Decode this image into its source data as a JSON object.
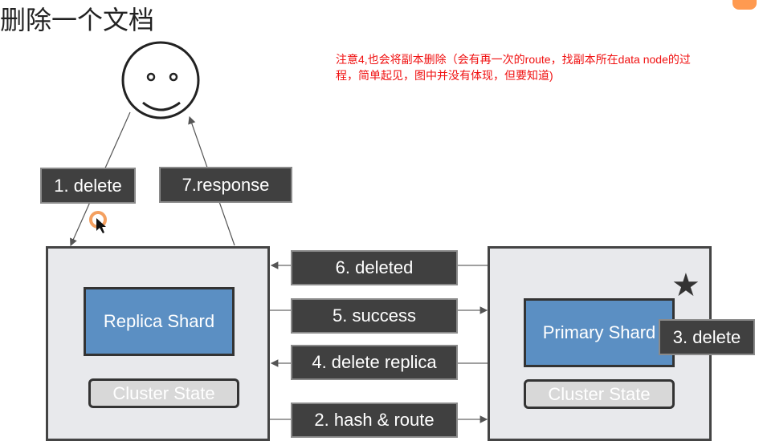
{
  "title": "删除一个文档",
  "note": "注意4,也会将副本删除（会有再一次的route，找副本所在data node的过程，简单起见，图中并没有体现，但要知道)",
  "client": {
    "icon": "smiley-face-icon"
  },
  "steps": {
    "s1": "1. delete",
    "s7": "7.response",
    "s6": "6. deleted",
    "s5": "5. success",
    "s4": "4. delete replica",
    "s2": "2. hash & route",
    "s3": "3. delete"
  },
  "left_node": {
    "shard": "Replica Shard",
    "cluster_state": "Cluster State"
  },
  "right_node": {
    "shard": "Primary Shard",
    "cluster_state": "Cluster State",
    "marker": "★"
  },
  "colors": {
    "shard": "#5b8fc3",
    "label": "#404040",
    "note": "#f01010",
    "node": "#e8e9ec"
  }
}
